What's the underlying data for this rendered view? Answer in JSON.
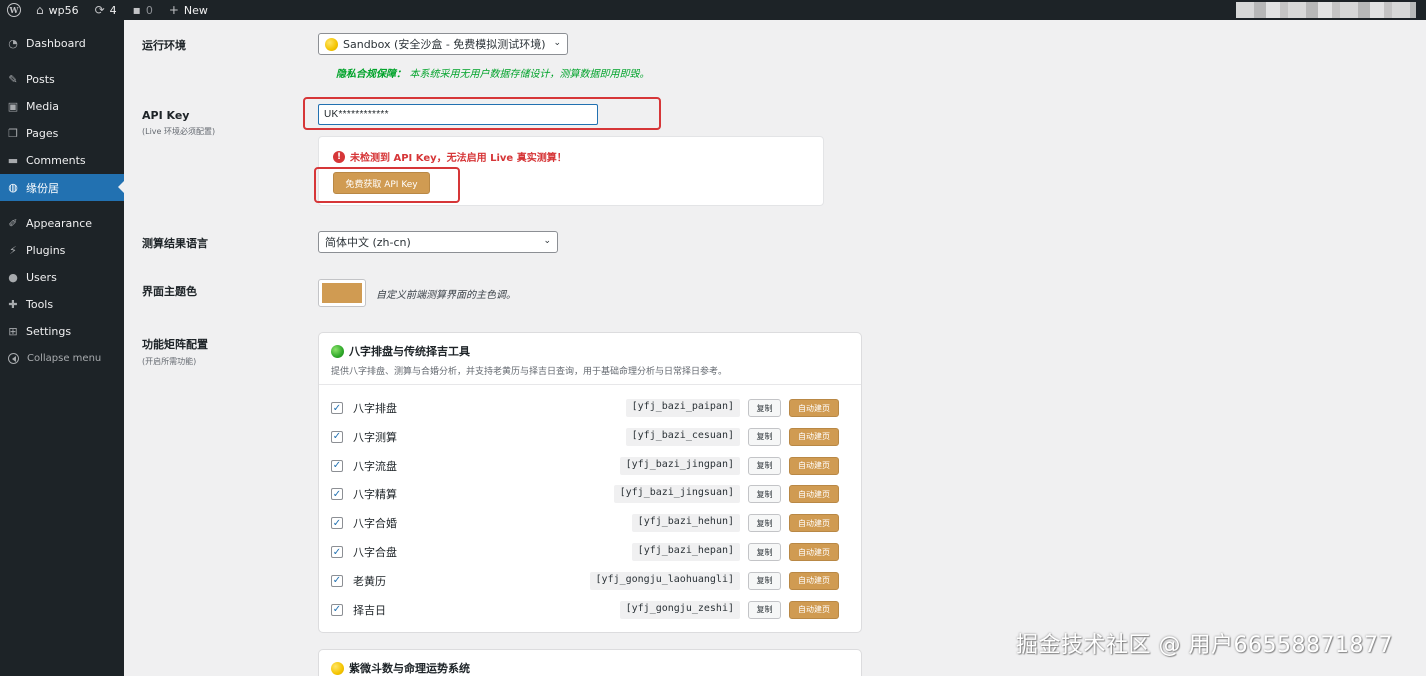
{
  "adminbar": {
    "site_name": "wp56",
    "updates_count": "4",
    "comments_count": "0",
    "new_label": "New"
  },
  "sidebar": {
    "items": [
      {
        "label": "Dashboard",
        "icon": "dashboard-icon"
      },
      {
        "label": "Posts",
        "icon": "pin-icon"
      },
      {
        "label": "Media",
        "icon": "media-icon"
      },
      {
        "label": "Pages",
        "icon": "pages-icon"
      },
      {
        "label": "Comments",
        "icon": "comments-icon"
      },
      {
        "label": "缘份居",
        "icon": "globe-icon",
        "current": true
      },
      {
        "label": "Appearance",
        "icon": "brush-icon"
      },
      {
        "label": "Plugins",
        "icon": "plug-icon"
      },
      {
        "label": "Users",
        "icon": "users-icon"
      },
      {
        "label": "Tools",
        "icon": "wrench-icon"
      },
      {
        "label": "Settings",
        "icon": "settings-icon"
      }
    ],
    "collapse_label": "Collapse menu"
  },
  "settings": {
    "env_label": "运行环境",
    "env_value": "Sandbox (安全沙盒 - 免费模拟测试环境)",
    "privacy_strong": "隐私合规保障：",
    "privacy_text": "本系统采用无用户数据存储设计，测算数据即用即毁。",
    "apikey_label": "API Key",
    "apikey_sub": "(Live 环境必须配置)",
    "apikey_value": "UK************",
    "alert_text": "未检测到 API Key，无法启用 Live 真实测算！",
    "get_key_button": "免费获取 API Key",
    "lang_label": "测算结果语言",
    "lang_value": "简体中文 (zh-cn)",
    "theme_label": "界面主题色",
    "theme_color": "#d09b52",
    "theme_desc": "自定义前端测算界面的主色调。",
    "matrix_label": "功能矩阵配置",
    "matrix_sub": "(开启所需功能)"
  },
  "groups": [
    {
      "title": "八字排盘与传统择吉工具",
      "desc": "提供八字排盘、测算与合婚分析，并支持老黄历与择吉日查询，用于基础命理分析与日常择日参考。",
      "copy_label": "复制",
      "auto_label": "自动建页",
      "items": [
        {
          "name": "八字排盘",
          "code": "[yfj_bazi_paipan]",
          "checked": true
        },
        {
          "name": "八字测算",
          "code": "[yfj_bazi_cesuan]",
          "checked": true
        },
        {
          "name": "八字流盘",
          "code": "[yfj_bazi_jingpan]",
          "checked": true
        },
        {
          "name": "八字精算",
          "code": "[yfj_bazi_jingsuan]",
          "checked": true
        },
        {
          "name": "八字合婚",
          "code": "[yfj_bazi_hehun]",
          "checked": true
        },
        {
          "name": "八字合盘",
          "code": "[yfj_bazi_hepan]",
          "checked": true
        },
        {
          "name": "老黄历",
          "code": "[yfj_gongju_laohuangli]",
          "checked": true
        },
        {
          "name": "择吉日",
          "code": "[yfj_gongju_zeshi]",
          "checked": true
        }
      ]
    },
    {
      "title": "紫微斗数与命理运势系统"
    }
  ],
  "watermark": "掘金技术社区 @ 用户66558871877",
  "colors": {
    "accent_blue": "#2271b1",
    "gold": "#d09b52",
    "alert_red": "#d63638",
    "privacy_green": "#00a32a"
  }
}
